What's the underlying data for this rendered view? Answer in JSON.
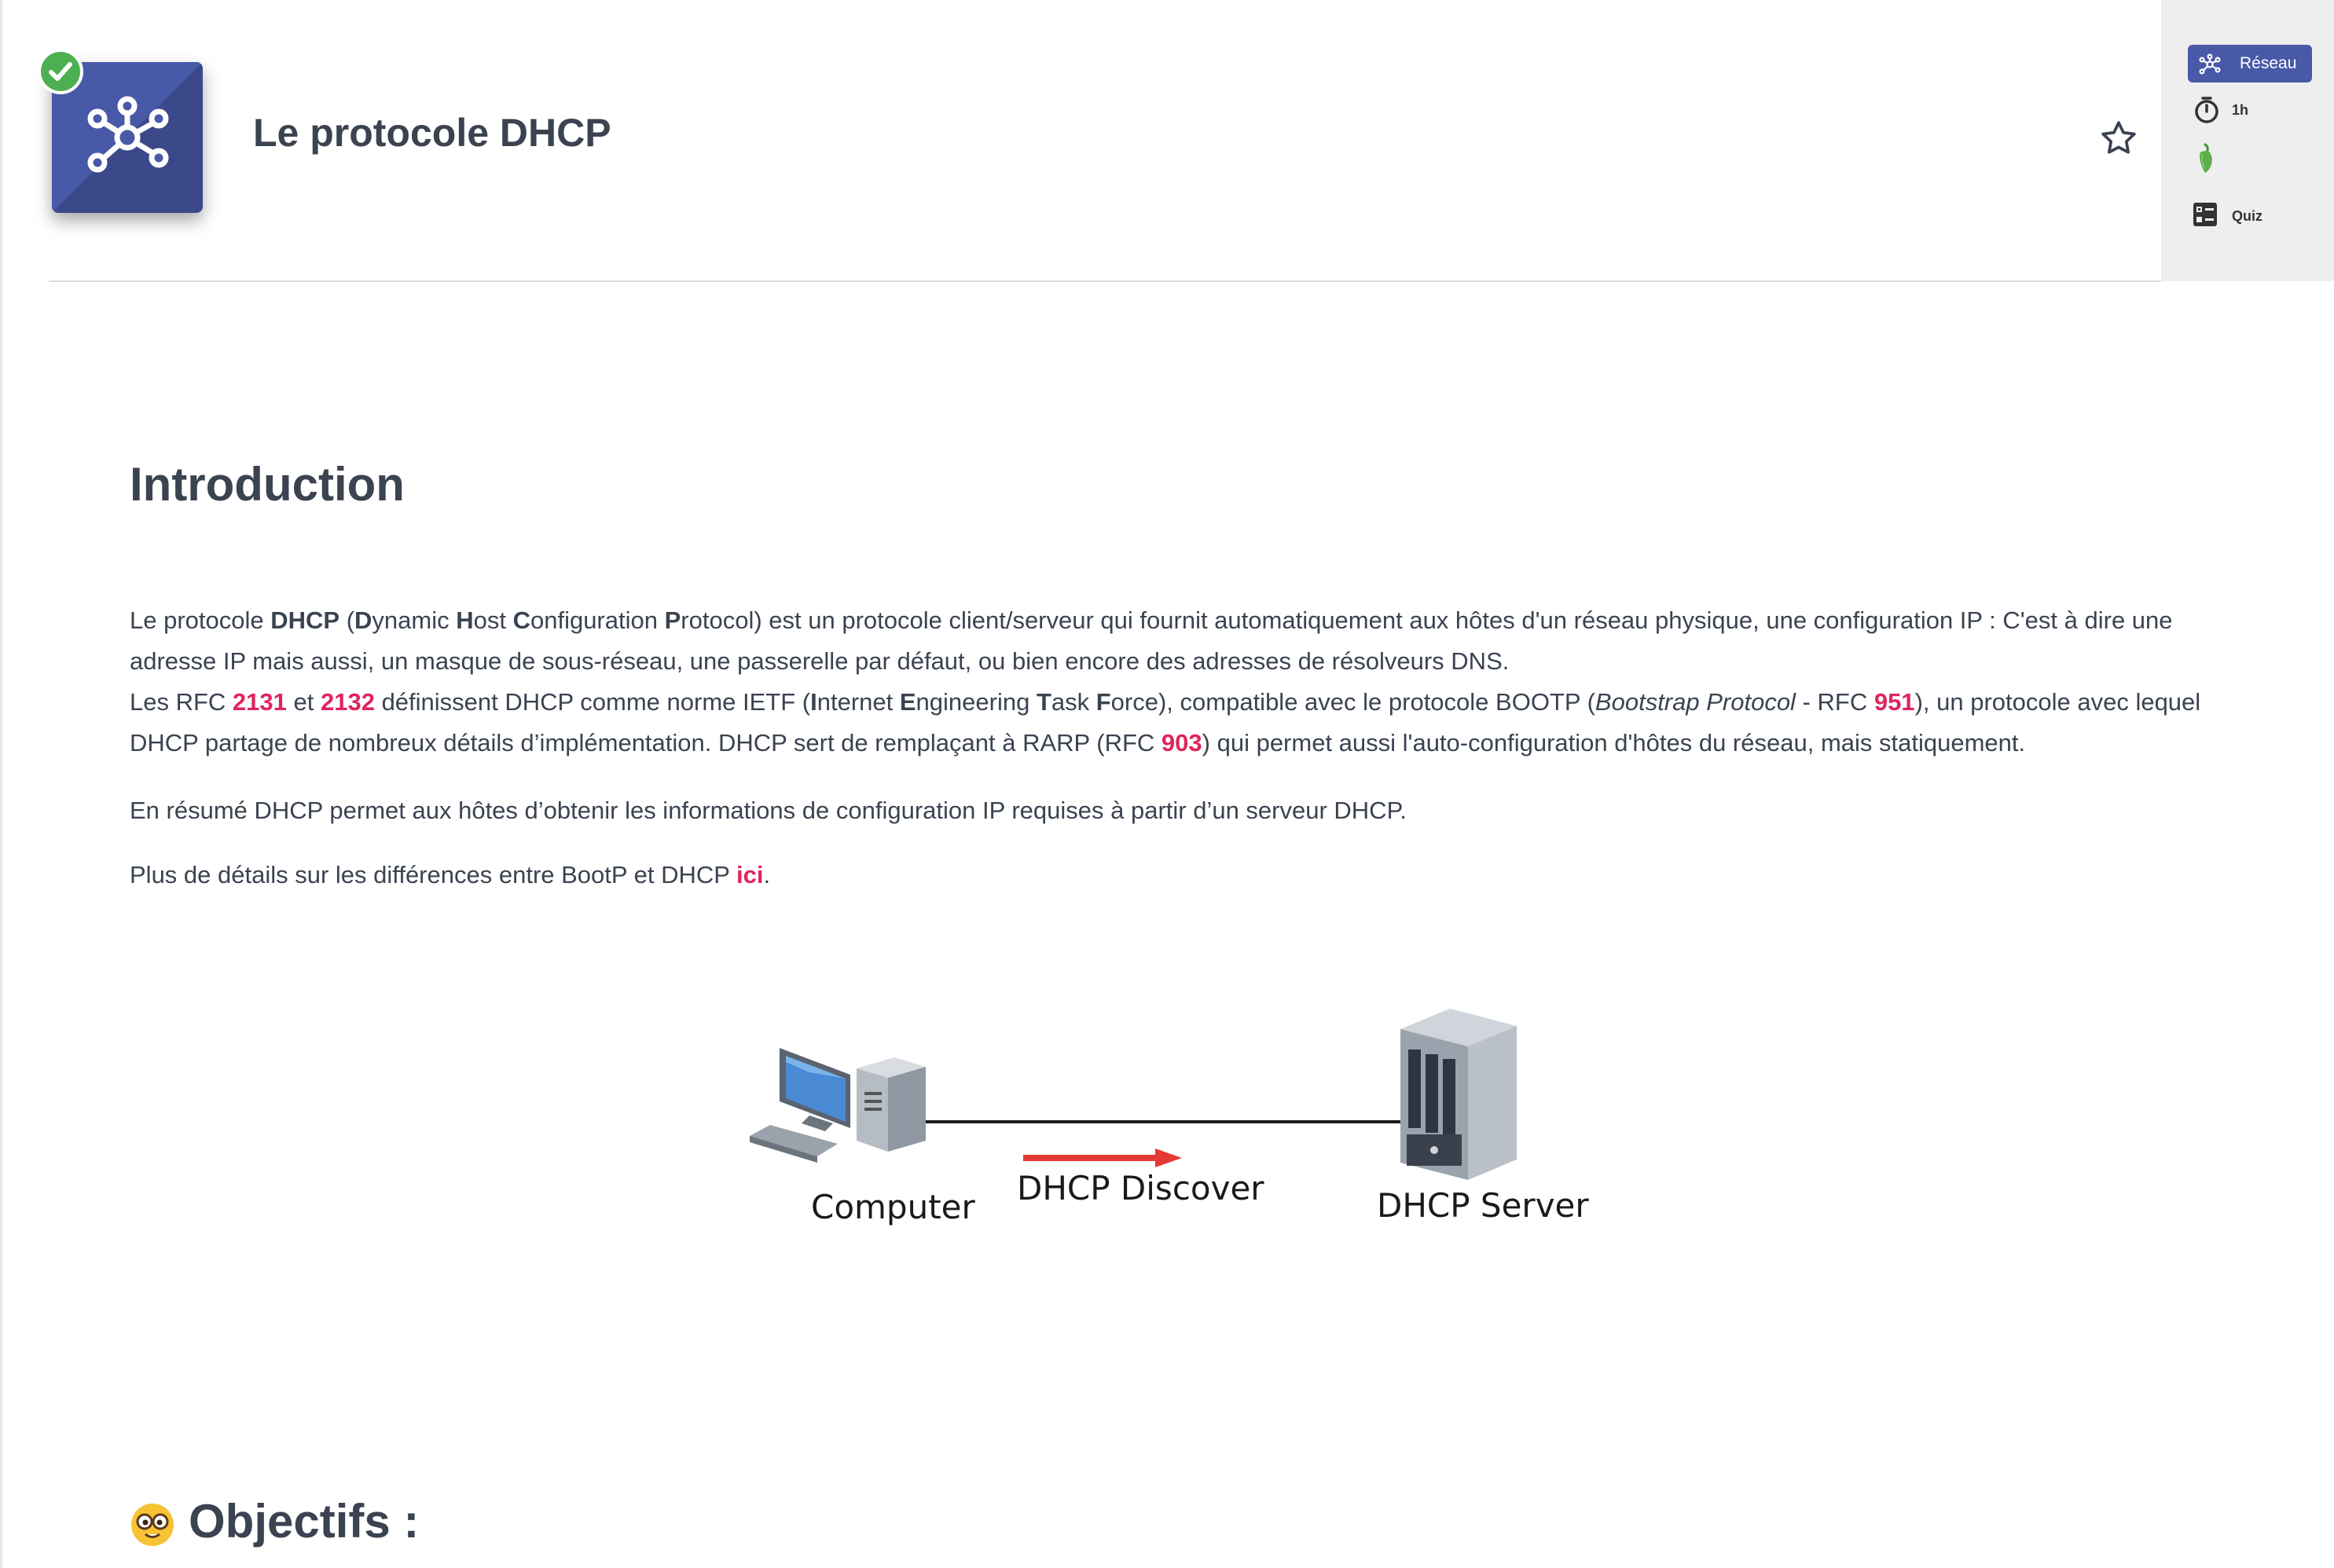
{
  "header": {
    "title": "Le protocole DHCP"
  },
  "meta": {
    "tag": "Réseau",
    "duration": "1h",
    "quiz": "Quiz",
    "accent_color": "#4859a8",
    "difficulty_color": "#5cae4a"
  },
  "intro": {
    "heading": "Introduction",
    "p1": {
      "t1": "Le protocole ",
      "dhcp": "DHCP",
      "t2": " (",
      "d": "D",
      "ynamic": "ynamic ",
      "h": "H",
      "ost": "ost ",
      "c": "C",
      "onfiguration": "onfiguration ",
      "p": "P",
      "rotocol": "rotocol) est un protocole client/serveur qui fournit automatiquement aux hôtes d'un réseau physique, une configuration IP : C'est à dire une adresse IP mais aussi, un masque de sous-réseau, une passerelle par défaut, ou bien encore des adresses de résolveurs DNS.",
      "l2a": "Les RFC ",
      "rfc1": "2131",
      "l2b": " et ",
      "rfc2": "2132",
      "l2c": " définissent DHCP comme norme IETF (",
      "i": "I",
      "nternet": "nternet ",
      "e": "E",
      "ngineering": "ngineering ",
      "tt": "T",
      "ask": "ask ",
      "f": "F",
      "orce": "orce), compatible avec le protocole BOOTP (",
      "bootstrap": "Bootstrap Protocol",
      "l2d": " - RFC ",
      "rfc3": "951",
      "l2e": "), un protocole avec lequel DHCP partage de nombreux détails d’implémentation. DHCP sert de remplaçant à RARP (RFC ",
      "rfc4": "903",
      "l2f": ") qui permet aussi l'auto-configuration d'hôtes du réseau, mais statiquement."
    },
    "p2": "En résumé DHCP permet aux hôtes d’obtenir les informations de configuration IP requises à partir d’un serveur DHCP.",
    "p3a": "Plus de détails sur les différences entre BootP et DHCP ",
    "p3link": "ici",
    "p3b": "."
  },
  "diagram": {
    "computer_label": "Computer",
    "arrow_label": "DHCP Discover",
    "server_label": "DHCP Server",
    "arrow_color": "#e53935"
  },
  "objectifs": {
    "heading": "Objectifs :"
  }
}
